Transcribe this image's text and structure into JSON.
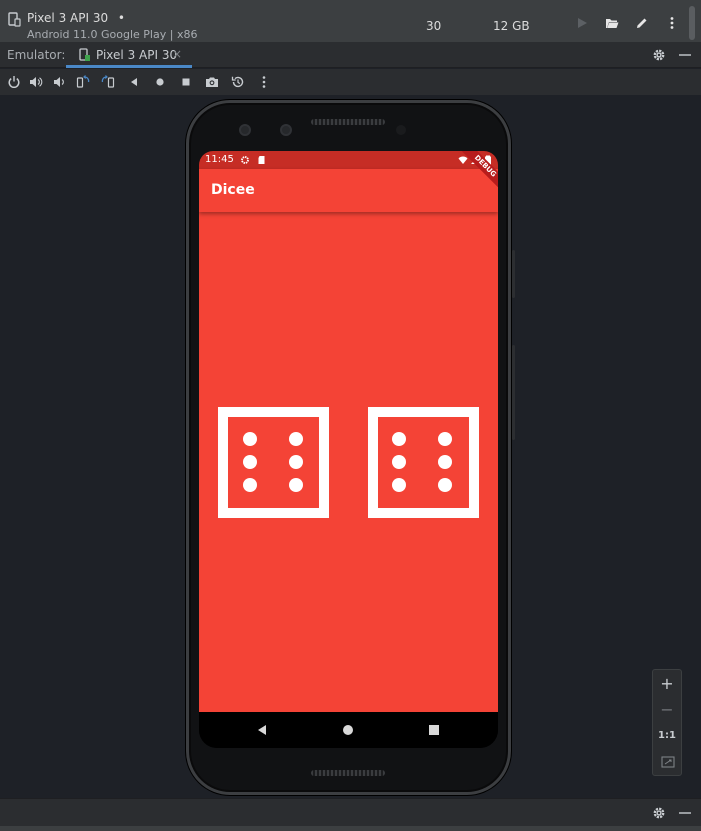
{
  "device_header": {
    "name": "Pixel 3 API 30",
    "status_dot": "•",
    "subtitle": "Android 11.0 Google Play | x86",
    "api_level": "30",
    "storage": "12 GB",
    "actions": [
      "run-icon",
      "folder-open-icon",
      "edit-icon",
      "more-vert-icon"
    ]
  },
  "tab_bar": {
    "label": "Emulator:",
    "tab": {
      "label": "Pixel 3 API 30",
      "close": "×"
    },
    "actions": [
      "gear-icon",
      "minimize-icon"
    ]
  },
  "emulator_toolbar": {
    "buttons": [
      "power-icon",
      "volume-up-icon",
      "volume-down-icon",
      "rotate-left-icon",
      "rotate-right-icon",
      "back-icon",
      "home-icon",
      "overview-icon",
      "screenshot-icon",
      "snapshot-icon",
      "more-icon"
    ]
  },
  "phone": {
    "status_bar": {
      "time": "11:45",
      "color": "#c62d25"
    },
    "debug_banner": "DEBUG",
    "app_bar": {
      "title": "Dicee",
      "color": "#f44336"
    },
    "background": "#f44336",
    "dice": [
      {
        "face": 6
      },
      {
        "face": 6
      }
    ],
    "nav_bar": [
      "nav-back-icon",
      "nav-home-icon",
      "nav-recents-icon"
    ]
  },
  "zoom_controls": {
    "zoom_in": "+",
    "zoom_out": "−",
    "one_to_one": "1:1",
    "fit": "fit-screen-icon"
  },
  "bottom_bar": {
    "actions": [
      "gear-icon",
      "minimize-icon"
    ]
  },
  "colors": {
    "ide_bg": "#1e2127",
    "panel": "#2b2d30",
    "header": "#3c3f41",
    "accent": "#4a88c7",
    "app_red": "#f44336"
  }
}
